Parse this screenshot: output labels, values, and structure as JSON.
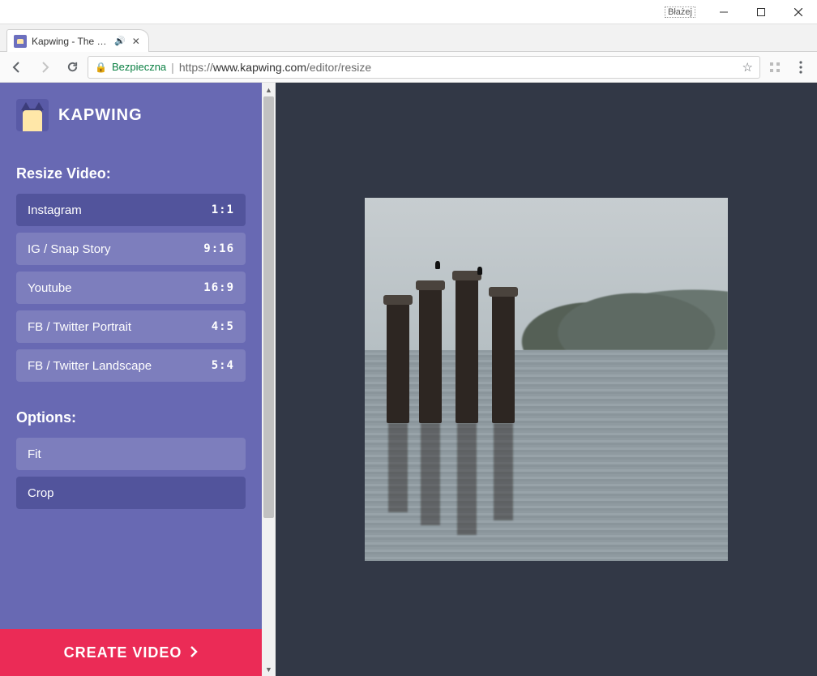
{
  "window": {
    "user": "Błażej"
  },
  "tab": {
    "title": "Kapwing - The Moder"
  },
  "address": {
    "secure_label": "Bezpieczna",
    "scheme": "https://",
    "host": "www.kapwing.com",
    "path": "/editor/resize"
  },
  "brand": "KAPWING",
  "sections": {
    "resize_title": "Resize Video:",
    "options_title": "Options:"
  },
  "resize_options": [
    {
      "label": "Instagram",
      "ratio": "1:1",
      "selected": true
    },
    {
      "label": "IG / Snap Story",
      "ratio": "9:16",
      "selected": false
    },
    {
      "label": "Youtube",
      "ratio": "16:9",
      "selected": false
    },
    {
      "label": "FB / Twitter Portrait",
      "ratio": "4:5",
      "selected": false
    },
    {
      "label": "FB / Twitter Landscape",
      "ratio": "5:4",
      "selected": false
    }
  ],
  "fit_options": [
    {
      "label": "Fit",
      "selected": false
    },
    {
      "label": "Crop",
      "selected": true
    }
  ],
  "cta": "CREATE VIDEO"
}
